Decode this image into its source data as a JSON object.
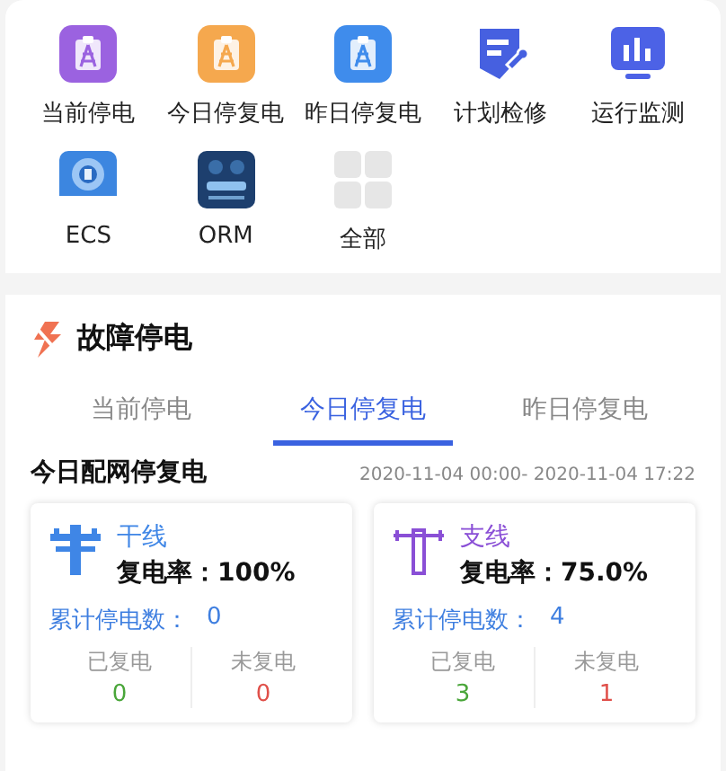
{
  "apps": [
    {
      "label": "当前停电",
      "kind": "clipboard",
      "color": "#9b62e0"
    },
    {
      "label": "今日停复电",
      "kind": "clipboard",
      "color": "#f5a84e"
    },
    {
      "label": "昨日停复电",
      "kind": "clipboard",
      "color": "#3f8cec"
    },
    {
      "label": "计划检修",
      "kind": "plan",
      "color": "#4660e0"
    },
    {
      "label": "运行监测",
      "kind": "monitor",
      "color": "#4c62e6"
    },
    {
      "label": "ECS",
      "kind": "ecs",
      "color": "#3c86e0"
    },
    {
      "label": "ORM",
      "kind": "orm",
      "color": "#1d3f6e"
    },
    {
      "label": "全部",
      "kind": "all",
      "color": "#e6e6e6"
    }
  ],
  "section": {
    "title": "故障停电"
  },
  "tabs": [
    {
      "label": "当前停电",
      "selected": false
    },
    {
      "label": "今日停复电",
      "selected": true
    },
    {
      "label": "昨日停复电",
      "selected": false
    }
  ],
  "summary": {
    "title": "今日配网停复电",
    "range": "2020-11-04 00:00- 2020-11-04 17:22"
  },
  "cards": [
    {
      "name": "干线",
      "kind": "trunk",
      "color": "#3f86e6",
      "rate": "复电率：100%",
      "total_label": "累计停电数：",
      "total": "0",
      "restored_label": "已复电",
      "restored": "0",
      "pending_label": "未复电",
      "pending": "0"
    },
    {
      "name": "支线",
      "kind": "branch",
      "color": "#8a4fd6",
      "rate": "复电率：75.0%",
      "total_label": "累计停电数：",
      "total": "4",
      "restored_label": "已复电",
      "restored": "3",
      "pending_label": "未复电",
      "pending": "1"
    }
  ]
}
